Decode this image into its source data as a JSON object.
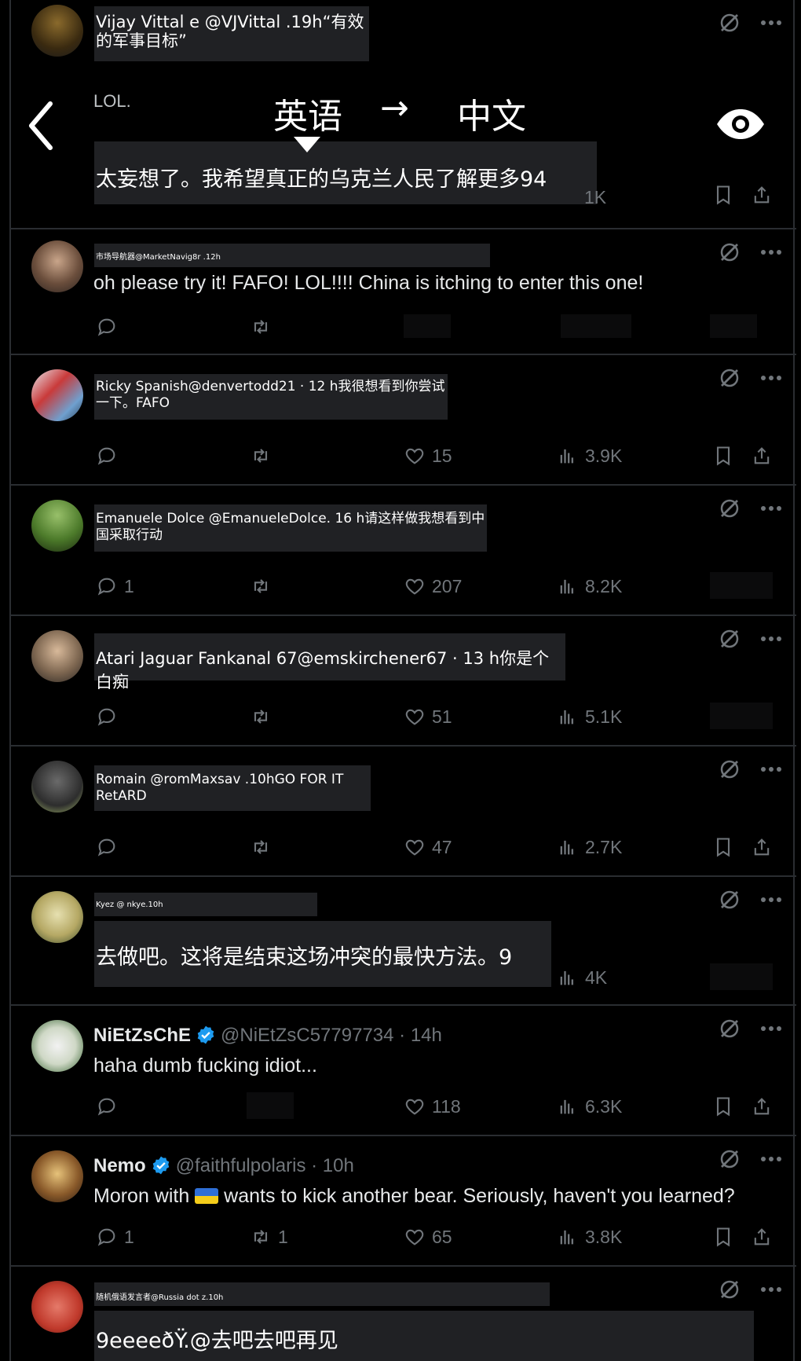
{
  "translation_bar": {
    "source_language": "英语",
    "arrow": "→",
    "target_language": "中文"
  },
  "tweets": [
    {
      "header_overlay": "Vijay Vittal e @VJVittal .19h“有效的军事目标”",
      "body": "LOL.",
      "body_overlay": "太妄想了。我希望真正的乌克兰人民了解更多94",
      "views": "1K"
    },
    {
      "header_overlay": "市场导航器@MarketNavig8r .12h",
      "body": "oh please try it!  FAFO! LOL!!!!  China is itching to enter this one!"
    },
    {
      "header_overlay": "Ricky Spanish@denvertodd21 · 12 h我很想看到你尝试一下。FAFO",
      "likes": "15",
      "views": "3.9K"
    },
    {
      "header_overlay": "Emanuele Dolce @EmanueleDolce. 16 h请这样做我想看到中国采取行动",
      "replies": "1",
      "likes": "207",
      "views": "8.2K"
    },
    {
      "header_overlay": "Atari Jaguar Fankanal 67@emskirchener67 · 13 h你是个白痴",
      "likes": "51",
      "views": "5.1K"
    },
    {
      "header_overlay": "Romain @romMaxsav .10hGO FOR IT RetARD",
      "likes": "47",
      "views": "2.7K"
    },
    {
      "header_overlay": "Kyez @ nkye.10h",
      "body_overlay": "去做吧。这将是结束这场冲突的最快方法。9",
      "views": "4K"
    },
    {
      "name": "NiEtZsChE",
      "handle": "@NiEtZsC57797734 · 14h",
      "body": "haha dumb fucking idiot...",
      "likes": "118",
      "views": "6.3K"
    },
    {
      "name": "Nemo",
      "handle": "@faithfulpolaris · 10h",
      "body_before_flag": "Moron with ",
      "body_after_flag": " wants to kick another bear. Seriously, haven't you learned?",
      "replies": "1",
      "retweets": "1",
      "likes": "65",
      "views": "3.8K"
    },
    {
      "header_overlay": "随机俄语发言者@Russia dot z.10h",
      "body_overlay": "9eeeeðŸ.@去吧去吧再见"
    }
  ],
  "colors": {
    "background": "#000000",
    "text": "#e7e9ea",
    "muted": "#71767b",
    "divider": "#2a2d31",
    "overlay": "#202124",
    "verified": "#1d9bf0"
  }
}
